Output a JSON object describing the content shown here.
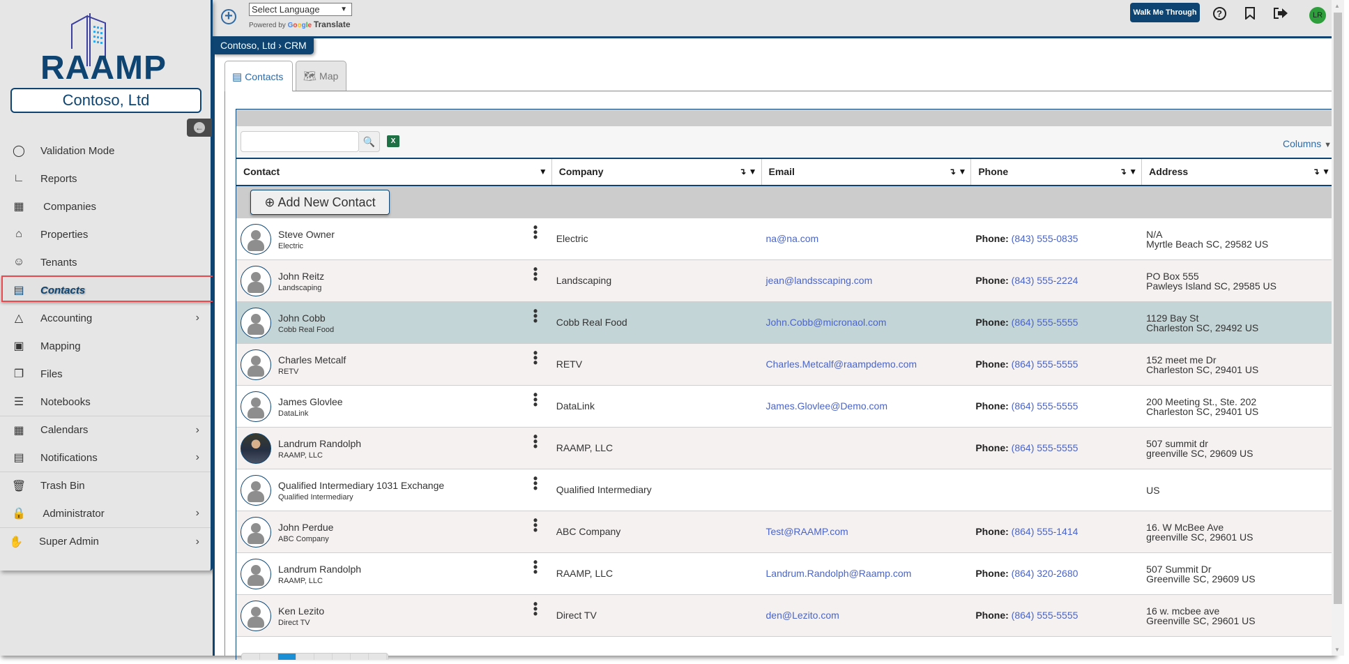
{
  "app": {
    "brand": "RAAMP",
    "organization": "Contoso, Ltd"
  },
  "sidebar": {
    "items": [
      {
        "label": "Validation Mode",
        "icon": "circle-icon",
        "chevron": false,
        "active": false
      },
      {
        "label": "Reports",
        "icon": "line-chart-icon",
        "chevron": false,
        "active": false
      },
      {
        "label": " Companies",
        "icon": "building-icon",
        "chevron": false,
        "active": false
      },
      {
        "label": "Properties",
        "icon": "house-icon",
        "chevron": false,
        "active": false
      },
      {
        "label": "Tenants",
        "icon": "user-icon",
        "chevron": false,
        "active": false
      },
      {
        "label": "Contacts",
        "icon": "id-card-icon",
        "chevron": false,
        "active": true
      },
      {
        "label": "Accounting",
        "icon": "area-chart-icon",
        "chevron": true,
        "active": false
      },
      {
        "label": "Mapping",
        "icon": "map-icon",
        "chevron": false,
        "active": false
      },
      {
        "label": "Files",
        "icon": "files-icon",
        "chevron": false,
        "active": false
      },
      {
        "label": "Notebooks",
        "icon": "notebook-icon",
        "chevron": false,
        "active": false
      },
      {
        "label": "Calendars",
        "icon": "calendar-icon",
        "chevron": true,
        "active": false
      },
      {
        "label": "Notifications",
        "icon": "newspaper-icon",
        "chevron": true,
        "active": false
      },
      {
        "label": "Trash Bin",
        "icon": "trash-icon",
        "chevron": false,
        "active": false
      },
      {
        "label": " Administrator",
        "icon": "lock-icon",
        "chevron": true,
        "active": false
      },
      {
        "label": "Super Admin",
        "icon": "hand-icon",
        "chevron": true,
        "active": false
      }
    ]
  },
  "topbar": {
    "language_select": "Select Language",
    "powered_by": "Powered by",
    "google": [
      "G",
      "o",
      "o",
      "g",
      "l",
      "e"
    ],
    "translate": "Translate",
    "walk_me_through": "Walk Me Through",
    "user_initials": "LR"
  },
  "breadcrumb": "Contoso, Ltd › CRM",
  "tabs": [
    {
      "label": "Contacts",
      "active": true
    },
    {
      "label": "Map",
      "active": false
    }
  ],
  "grid": {
    "search_placeholder": "",
    "columns_label": "Columns",
    "add_button": "⊕ Add New Contact",
    "headers": [
      "Contact",
      "Company",
      "Email",
      "Phone",
      "Address"
    ],
    "phone_label": "Phone:",
    "rows": [
      {
        "name": "Steve Owner",
        "sub": "Electric",
        "company": "Electric",
        "email": "na@na.com",
        "phone": "(843) 555-0835",
        "addr1": "N/A",
        "addr2": "Myrtle Beach SC, 29582 US",
        "style": "white",
        "photo": false
      },
      {
        "name": "John Reitz",
        "sub": "Landscaping",
        "company": "Landscaping",
        "email": "jean@landsscaping.com",
        "phone": "(843) 555-2224",
        "addr1": "PO Box 555",
        "addr2": "Pawleys Island SC, 29585 US",
        "style": "alt",
        "photo": false
      },
      {
        "name": "John Cobb",
        "sub": "Cobb Real Food",
        "company": "Cobb Real Food",
        "email": "John.Cobb@micronaol.com",
        "phone": "(864) 555-5555",
        "addr1": "1129 Bay St",
        "addr2": "Charleston SC, 29492 US",
        "style": "selected",
        "photo": false
      },
      {
        "name": "Charles Metcalf",
        "sub": "RETV",
        "company": "RETV",
        "email": "Charles.Metcalf@raampdemo.com",
        "phone": "(864) 555-5555",
        "addr1": "152 meet me Dr",
        "addr2": "Charleston SC, 29401 US",
        "style": "alt",
        "photo": false
      },
      {
        "name": "James Glovlee",
        "sub": "DataLink",
        "company": "DataLink",
        "email": "James.Glovlee@Demo.com",
        "phone": "(864) 555-5555",
        "addr1": "200 Meeting St., Ste. 202",
        "addr2": "Charleston SC, 29401 US",
        "style": "white",
        "photo": false
      },
      {
        "name": "Landrum Randolph",
        "sub": "RAAMP, LLC",
        "company": "RAAMP, LLC",
        "email": "",
        "phone": "(864) 555-5555",
        "addr1": "507 summit dr",
        "addr2": "greenville SC, 29609 US",
        "style": "alt",
        "photo": true
      },
      {
        "name": "Qualified Intermediary 1031 Exchange",
        "sub": "Qualified Intermediary",
        "company": "Qualified Intermediary",
        "email": "",
        "phone": "",
        "addr1": "",
        "addr2": "US",
        "style": "white",
        "photo": false
      },
      {
        "name": "John Perdue",
        "sub": "ABC Company",
        "company": "ABC Company",
        "email": "Test@RAAMP.com",
        "phone": "(864) 555-1414",
        "addr1": "16. W McBee Ave",
        "addr2": "greenville SC, 29601 US",
        "style": "alt",
        "photo": false
      },
      {
        "name": "Landrum Randolph",
        "sub": "RAAMP, LLC",
        "company": "RAAMP, LLC",
        "email": "Landrum.Randolph@Raamp.com",
        "phone": "(864) 320-2680",
        "addr1": "507 Summit Dr",
        "addr2": "Greenville SC, 29609 US",
        "style": "white",
        "photo": false
      },
      {
        "name": "Ken Lezito",
        "sub": "Direct TV",
        "company": "Direct TV",
        "email": "den@Lezito.com",
        "phone": "(864) 555-5555",
        "addr1": "16 w. mcbee ave",
        "addr2": "Greenville  SC, 29601 US",
        "style": "alt",
        "photo": false
      }
    ],
    "pager": {
      "current_page": 3,
      "visible_pages": 8
    }
  },
  "colors": {
    "brand_navy": "#0d4472",
    "link_blue": "#4a64c9",
    "highlight_red": "#e84a4f",
    "selected_row": "#c3d5d6",
    "avatar_green": "#2e9e3c",
    "excel_green": "#1e7145"
  }
}
